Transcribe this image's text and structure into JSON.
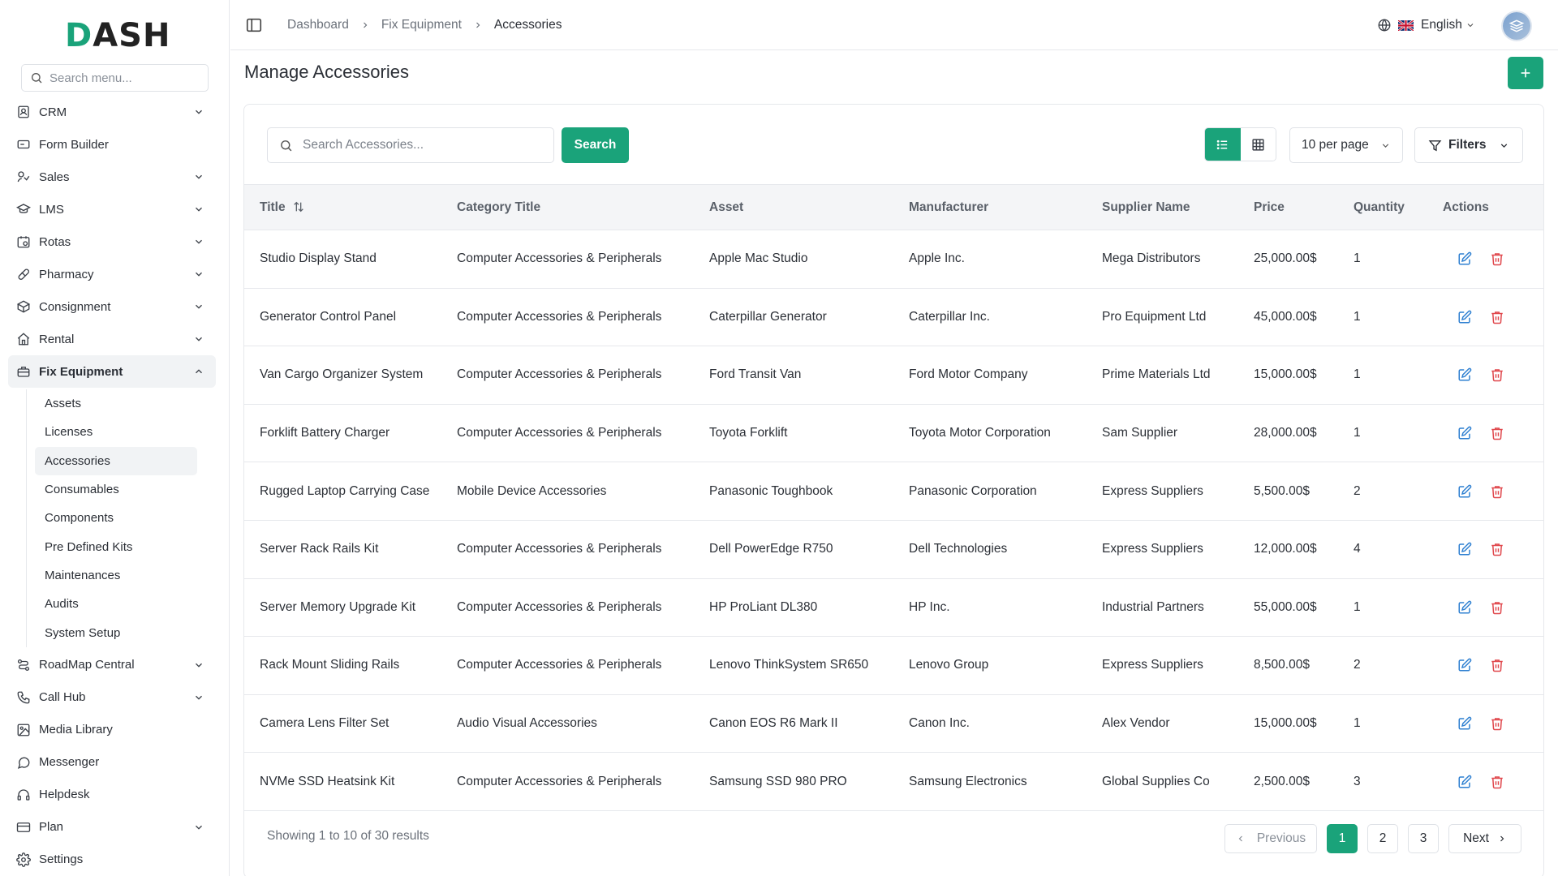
{
  "app": {
    "logo_prefix": "D",
    "logo_rest": "ASH"
  },
  "sidebar": {
    "search_placeholder": "Search menu...",
    "items": [
      {
        "label": "CRM",
        "icon": "contact-book-icon",
        "expandable": true
      },
      {
        "label": "Form Builder",
        "icon": "form-icon",
        "expandable": false
      },
      {
        "label": "Sales",
        "icon": "sales-icon",
        "expandable": true
      },
      {
        "label": "LMS",
        "icon": "graduation-cap-icon",
        "expandable": true
      },
      {
        "label": "Rotas",
        "icon": "calendar-icon",
        "expandable": true
      },
      {
        "label": "Pharmacy",
        "icon": "pill-icon",
        "expandable": true
      },
      {
        "label": "Consignment",
        "icon": "box-icon",
        "expandable": true
      },
      {
        "label": "Rental",
        "icon": "home-icon",
        "expandable": true
      },
      {
        "label": "Fix Equipment",
        "icon": "toolbox-icon",
        "expandable": true,
        "expanded": true
      }
    ],
    "fix_equipment_sub": [
      {
        "label": "Assets"
      },
      {
        "label": "Licenses"
      },
      {
        "label": "Accessories",
        "active": true
      },
      {
        "label": "Consumables"
      },
      {
        "label": "Components"
      },
      {
        "label": "Pre Defined Kits"
      },
      {
        "label": "Maintenances"
      },
      {
        "label": "Audits"
      },
      {
        "label": "System Setup"
      }
    ],
    "items_after": [
      {
        "label": "RoadMap Central",
        "icon": "roadmap-icon",
        "expandable": true
      },
      {
        "label": "Call Hub",
        "icon": "phone-icon",
        "expandable": true
      },
      {
        "label": "Media Library",
        "icon": "image-icon",
        "expandable": false
      },
      {
        "label": "Messenger",
        "icon": "chat-icon",
        "expandable": false
      },
      {
        "label": "Helpdesk",
        "icon": "headset-icon",
        "expandable": false
      },
      {
        "label": "Plan",
        "icon": "card-icon",
        "expandable": true
      },
      {
        "label": "Settings",
        "icon": "gear-icon",
        "expandable": false
      }
    ]
  },
  "header": {
    "breadcrumb": [
      "Dashboard",
      "Fix Equipment",
      "Accessories"
    ],
    "language": "English"
  },
  "page": {
    "title": "Manage Accessories",
    "search_placeholder": "Search Accessories...",
    "search_button": "Search",
    "per_page": "10 per page",
    "filters": "Filters"
  },
  "table": {
    "columns": [
      "Title",
      "Category Title",
      "Asset",
      "Manufacturer",
      "Supplier Name",
      "Price",
      "Quantity",
      "Actions"
    ],
    "rows": [
      [
        "Studio Display Stand",
        "Computer Accessories & Peripherals",
        "Apple Mac Studio",
        "Apple Inc.",
        "Mega Distributors",
        "25,000.00$",
        "1"
      ],
      [
        "Generator Control Panel",
        "Computer Accessories & Peripherals",
        "Caterpillar Generator",
        "Caterpillar Inc.",
        "Pro Equipment Ltd",
        "45,000.00$",
        "1"
      ],
      [
        "Van Cargo Organizer System",
        "Computer Accessories & Peripherals",
        "Ford Transit Van",
        "Ford Motor Company",
        "Prime Materials Ltd",
        "15,000.00$",
        "1"
      ],
      [
        "Forklift Battery Charger",
        "Computer Accessories & Peripherals",
        "Toyota Forklift",
        "Toyota Motor Corporation",
        "Sam Supplier",
        "28,000.00$",
        "1"
      ],
      [
        "Rugged Laptop Carrying Case",
        "Mobile Device Accessories",
        "Panasonic Toughbook",
        "Panasonic Corporation",
        "Express Suppliers",
        "5,500.00$",
        "2"
      ],
      [
        "Server Rack Rails Kit",
        "Computer Accessories & Peripherals",
        "Dell PowerEdge R750",
        "Dell Technologies",
        "Express Suppliers",
        "12,000.00$",
        "4"
      ],
      [
        "Server Memory Upgrade Kit",
        "Computer Accessories & Peripherals",
        "HP ProLiant DL380",
        "HP Inc.",
        "Industrial Partners",
        "55,000.00$",
        "1"
      ],
      [
        "Rack Mount Sliding Rails",
        "Computer Accessories & Peripherals",
        "Lenovo ThinkSystem SR650",
        "Lenovo Group",
        "Express Suppliers",
        "8,500.00$",
        "2"
      ],
      [
        "Camera Lens Filter Set",
        "Audio Visual Accessories",
        "Canon EOS R6 Mark II",
        "Canon Inc.",
        "Alex Vendor",
        "15,000.00$",
        "1"
      ],
      [
        "NVMe SSD Heatsink Kit",
        "Computer Accessories & Peripherals",
        "Samsung SSD 980 PRO",
        "Samsung Electronics",
        "Global Supplies Co",
        "2,500.00$",
        "3"
      ]
    ]
  },
  "pagination": {
    "info": "Showing 1 to 10 of 30 results",
    "previous": "Previous",
    "pages": [
      "1",
      "2",
      "3"
    ],
    "current": "1",
    "next": "Next"
  },
  "colors": {
    "accent": "#1aa37a",
    "edit": "#2f80d1",
    "delete": "#e0474c"
  }
}
